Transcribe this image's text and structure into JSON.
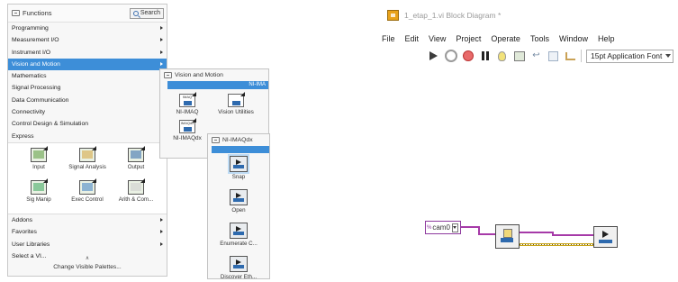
{
  "palette": {
    "title": "Functions",
    "search_label": "Search",
    "items_top": [
      {
        "label": "Programming",
        "arrow": true,
        "active": false
      },
      {
        "label": "Measurement I/O",
        "arrow": true,
        "active": false
      },
      {
        "label": "Instrument I/O",
        "arrow": true,
        "active": false
      },
      {
        "label": "Vision and Motion",
        "arrow": true,
        "active": true
      },
      {
        "label": "Mathematics",
        "arrow": true,
        "active": false
      },
      {
        "label": "Signal Processing",
        "arrow": true,
        "active": false
      },
      {
        "label": "Data Communication",
        "arrow": true,
        "active": false
      },
      {
        "label": "Connectivity",
        "arrow": true,
        "active": false
      },
      {
        "label": "Control Design & Simulation",
        "arrow": true,
        "active": false
      },
      {
        "label": "Express",
        "arrow": true,
        "active": false
      }
    ],
    "express_tiles": [
      {
        "label": "Input",
        "icon": "express-input-icon"
      },
      {
        "label": "Signal Analysis",
        "icon": "express-signal-analysis-icon"
      },
      {
        "label": "Output",
        "icon": "express-output-icon"
      },
      {
        "label": "Sig Manip",
        "icon": "express-sig-manip-icon"
      },
      {
        "label": "Exec Control",
        "icon": "express-exec-control-icon"
      },
      {
        "label": "Arith & Com...",
        "icon": "express-arith-comparison-icon"
      }
    ],
    "items_bottom": [
      {
        "label": "Addons",
        "arrow": true
      },
      {
        "label": "Favorites",
        "arrow": true
      },
      {
        "label": "User Libraries",
        "arrow": true
      },
      {
        "label": "Select a VI...",
        "arrow": false
      }
    ],
    "footer_label": "Change Visible Palettes..."
  },
  "vision_motion": {
    "title": "Vision and Motion",
    "bar_label": "NI-IMA",
    "tiles": [
      {
        "label": "NI-IMAQ",
        "icon": "ni-imaq-icon",
        "caption": "IMAQ"
      },
      {
        "label": "Vision Utilities",
        "icon": "vision-utilities-icon",
        "caption": ""
      },
      {
        "label": "NI-IMAQdx",
        "icon": "ni-imaqdx-icon",
        "caption": "IMAQdx"
      }
    ]
  },
  "imaqdx": {
    "title": "NI-IMAQdx",
    "tiles": [
      {
        "label": "Snap",
        "icon": "snap-icon",
        "selected": true
      },
      {
        "label": "Open",
        "icon": "open-camera-icon",
        "selected": false
      },
      {
        "label": "Enumerate C...",
        "icon": "enumerate-cameras-icon",
        "selected": false
      },
      {
        "label": "Discover Eth...",
        "icon": "discover-ethernet-icon",
        "selected": false
      }
    ]
  },
  "block_diagram": {
    "title": "1_etap_1.vi Block Diagram *",
    "menus": [
      "File",
      "Edit",
      "View",
      "Project",
      "Operate",
      "Tools",
      "Window",
      "Help"
    ],
    "font_label": "15pt Application Font",
    "camera_constant": "cam0"
  }
}
